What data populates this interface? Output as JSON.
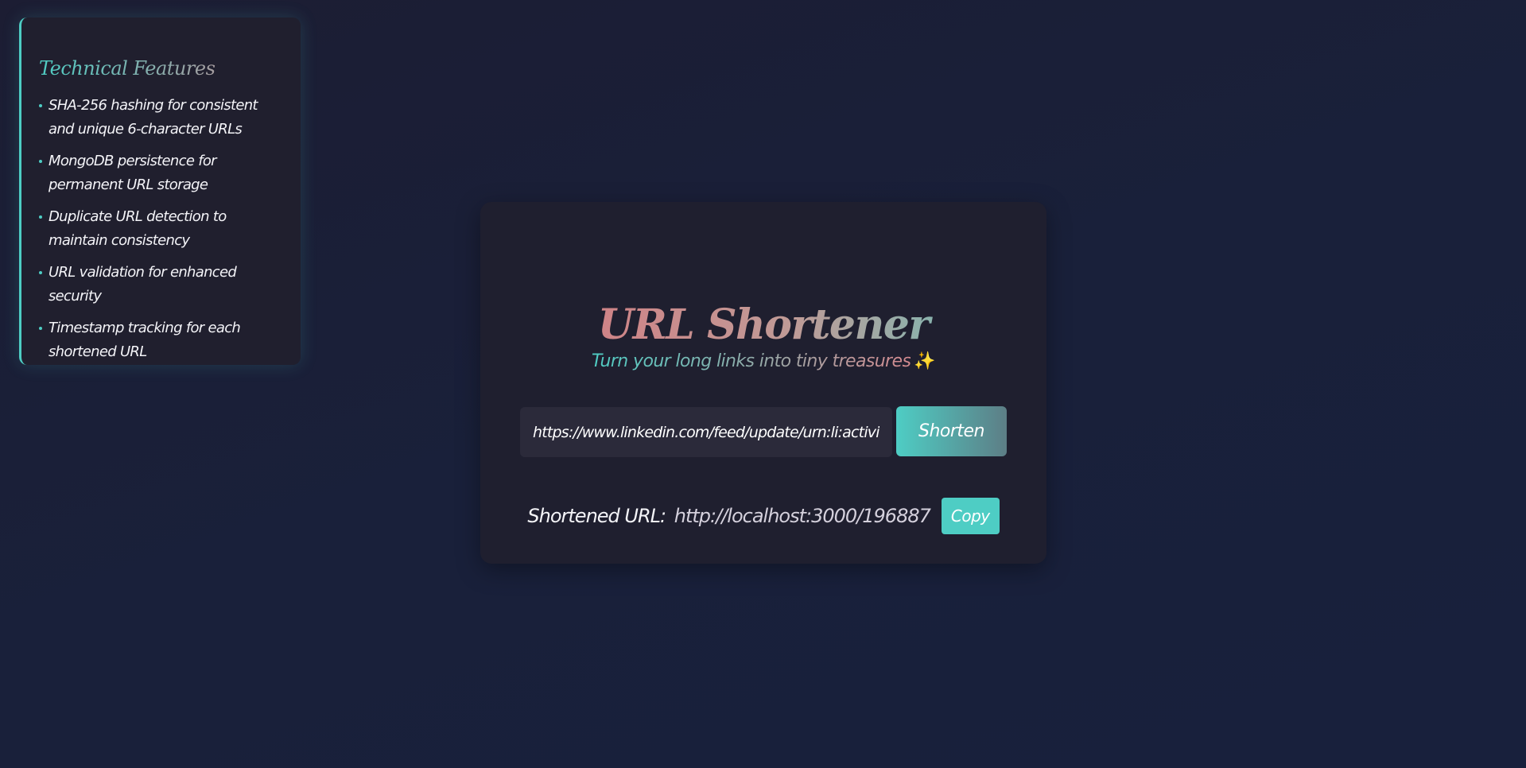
{
  "features": {
    "title": "Technical Features",
    "items": [
      "SHA-256 hashing for consistent and unique 6-character URLs",
      "MongoDB persistence for permanent URL storage",
      "Duplicate URL detection to maintain consistency",
      "URL validation for enhanced security",
      "Timestamp tracking for each shortened URL"
    ]
  },
  "main": {
    "title": "URL Shortener",
    "tagline": "Turn your long links into tiny treasures",
    "tagline_icon": "✨",
    "input": {
      "value": "https://www.linkedin.com/feed/update/urn:li:activity"
    },
    "shorten_label": "Shorten",
    "result": {
      "label": "Shortened URL:",
      "url": "http://localhost:3000/196887"
    },
    "copy_label": "Copy"
  },
  "colors": {
    "accent": "#4ecdc4",
    "rose": "#d8757d",
    "card": "#1f1f2f",
    "background": "#1a1d36"
  }
}
